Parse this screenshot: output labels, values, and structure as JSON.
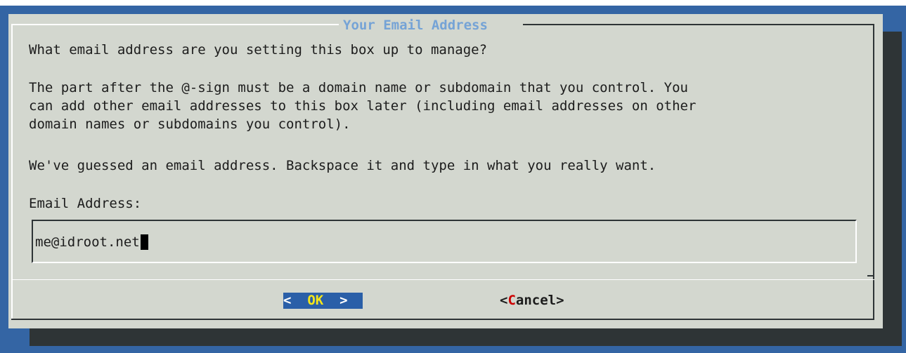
{
  "dialog": {
    "title": "Your Email Address",
    "question": "What email address are you setting this box up to manage?",
    "paragraph_lines": [
      "The part after the @-sign must be a domain name or subdomain that you control. You",
      "can add other email addresses to this box later (including email addresses on other",
      "domain names or subdomains you control)."
    ],
    "guess_note": "We've guessed an email address. Backspace it and type in what you really want.",
    "field_label": "Email Address:",
    "field_value": "me@idroot.net"
  },
  "buttons": {
    "ok": {
      "left_bracket": "<  ",
      "hotkey": "O",
      "rest": "K",
      "right_bracket": "  >"
    },
    "cancel": {
      "left_bracket": "<",
      "hotkey": "C",
      "rest": "ancel",
      "right_bracket": ">"
    }
  },
  "colors": {
    "screen_background": "#3465a4",
    "dialog_background": "#d3d7cf",
    "shadow": "#2e3436",
    "title": "#75a3d6",
    "selected_button": "#2a5fa8",
    "selected_hotkey": "#f5e61a",
    "hotkey": "#cc0000"
  }
}
